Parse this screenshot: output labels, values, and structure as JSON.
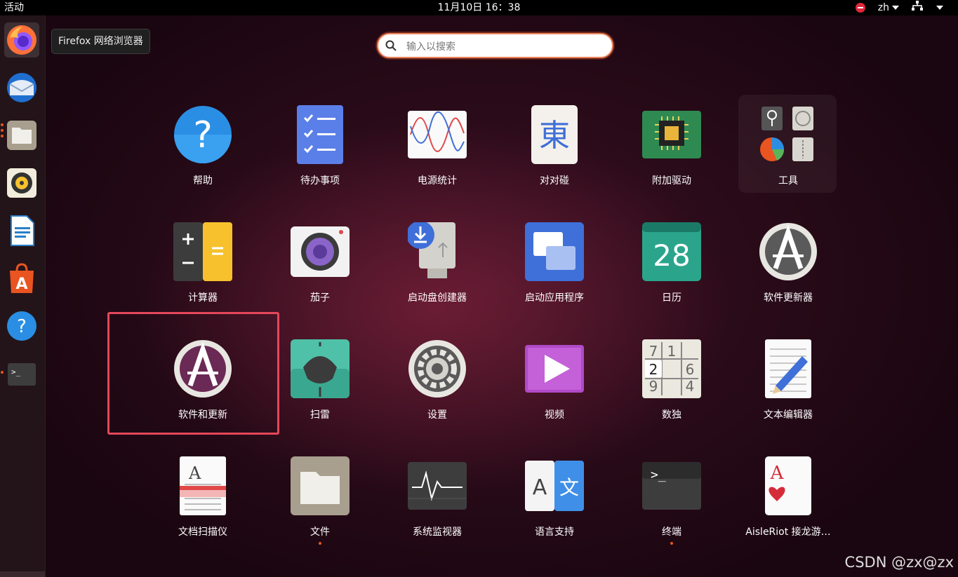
{
  "topbar": {
    "activities": "活动",
    "clock": "11月10日  16：38",
    "input_method": "zh"
  },
  "tooltip": "Firefox 网络浏览器",
  "search": {
    "placeholder": "输入以搜索"
  },
  "apps": [
    {
      "label": "帮助",
      "icon": "help-icon"
    },
    {
      "label": "待办事项",
      "icon": "todo-icon"
    },
    {
      "label": "电源统计",
      "icon": "power-statistics-icon"
    },
    {
      "label": "对对碰",
      "icon": "mahjongg-icon",
      "glyph": "東"
    },
    {
      "label": "附加驱动",
      "icon": "chip-icon"
    },
    {
      "label": "工具",
      "icon": "utilities-folder-icon"
    },
    {
      "label": "计算器",
      "icon": "calculator-icon"
    },
    {
      "label": "茄子",
      "icon": "cheese-camera-icon"
    },
    {
      "label": "启动盘创建器",
      "icon": "usb-creator-icon"
    },
    {
      "label": "启动应用程序",
      "icon": "startup-apps-icon"
    },
    {
      "label": "日历",
      "icon": "calendar-icon",
      "glyph": "28"
    },
    {
      "label": "软件更新器",
      "icon": "software-updater-icon"
    },
    {
      "label": "软件和更新",
      "icon": "software-properties-icon"
    },
    {
      "label": "扫雷",
      "icon": "mines-icon"
    },
    {
      "label": "设置",
      "icon": "settings-gear-icon"
    },
    {
      "label": "视频",
      "icon": "videos-icon"
    },
    {
      "label": "数独",
      "icon": "sudoku-icon"
    },
    {
      "label": "文本编辑器",
      "icon": "text-editor-icon"
    },
    {
      "label": "文档扫描仪",
      "icon": "document-scanner-icon"
    },
    {
      "label": "文件",
      "icon": "files-icon"
    },
    {
      "label": "系统监视器",
      "icon": "system-monitor-icon"
    },
    {
      "label": "语言支持",
      "icon": "language-support-icon"
    },
    {
      "label": "终端",
      "icon": "terminal-icon"
    },
    {
      "label": "AisleRiot 接龙游…",
      "icon": "aisleriot-card-icon"
    }
  ],
  "sudoku": [
    "7",
    "1",
    "2",
    "6",
    "9",
    "4"
  ],
  "dock": [
    "firefox-icon",
    "thunderbird-icon",
    "files-icon",
    "rhythmbox-icon",
    "libreoffice-writer-icon",
    "ubuntu-software-icon",
    "help-icon",
    "terminal-icon"
  ],
  "watermark": "CSDN @zx@zx",
  "colors": {
    "accent": "#e95420",
    "highlight_box": "#e5475a"
  }
}
